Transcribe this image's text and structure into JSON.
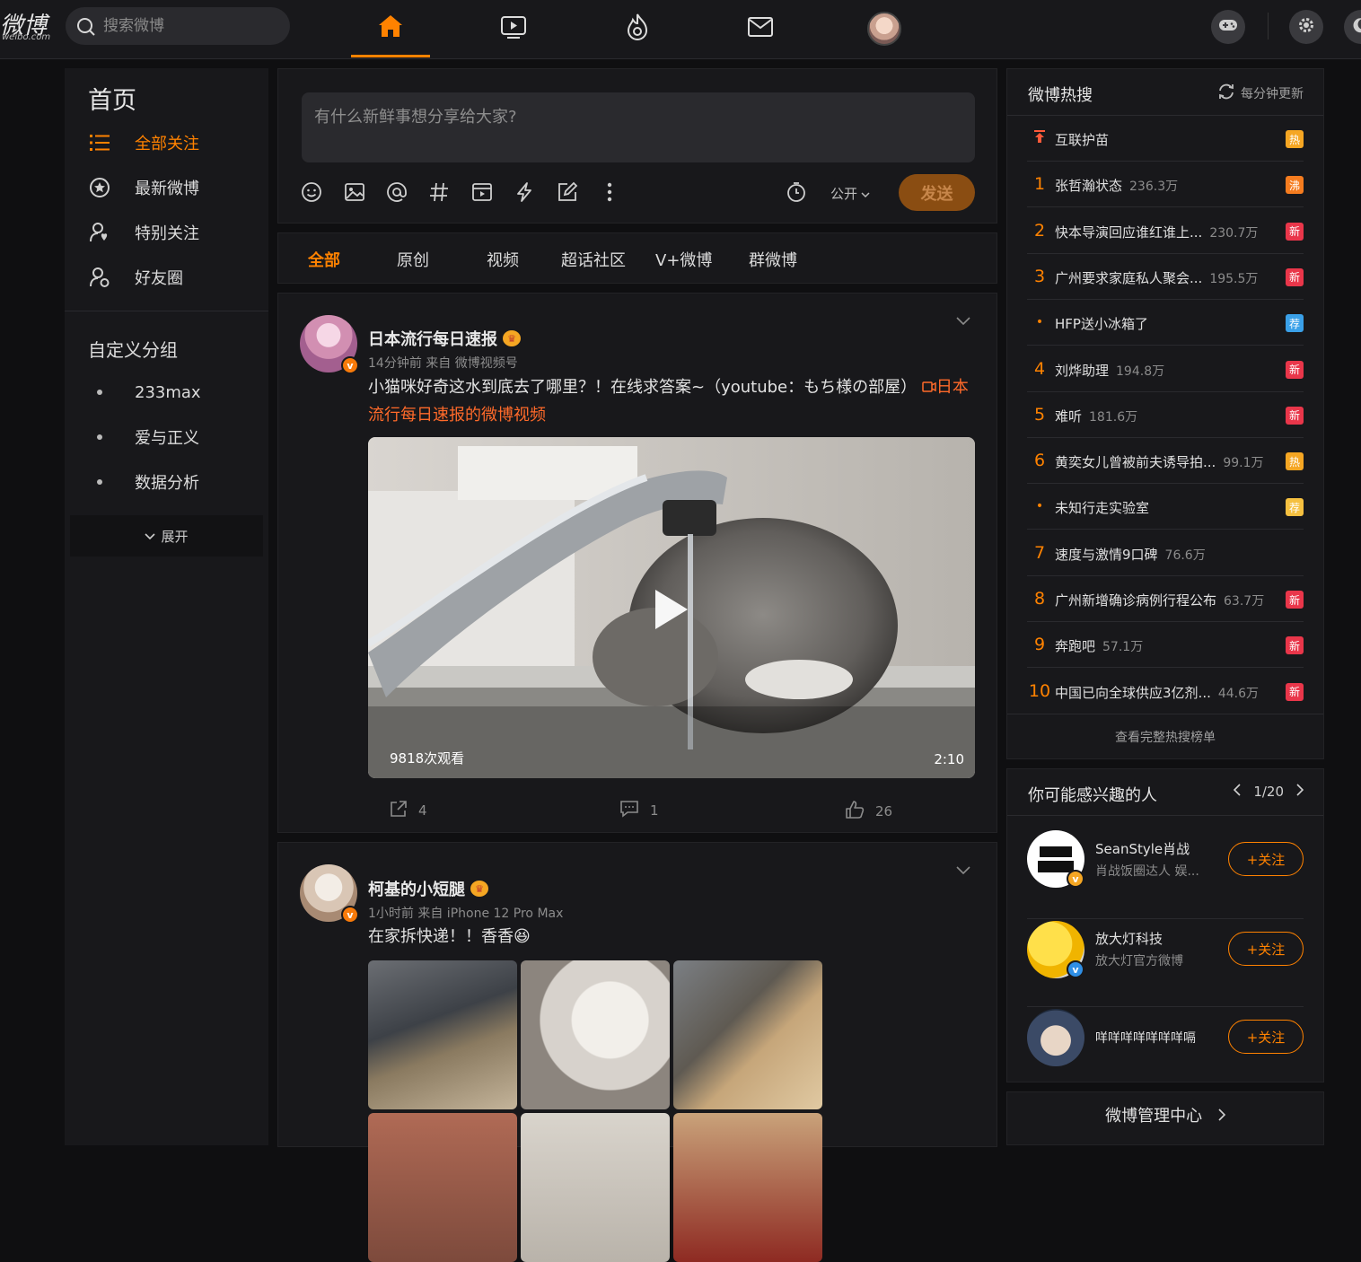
{
  "header": {
    "logo_text": "微博",
    "logo_sub": "weibo.com",
    "search_placeholder": "搜索微博",
    "nav": [
      "home-icon",
      "video-icon",
      "hot-icon",
      "mail-icon",
      "avatar"
    ]
  },
  "left_nav": {
    "title": "首页",
    "items": [
      {
        "label": "全部关注",
        "icon": "list-icon",
        "active": true
      },
      {
        "label": "最新微博",
        "icon": "star-icon"
      },
      {
        "label": "特别关注",
        "icon": "special-follow-icon"
      },
      {
        "label": "好友圈",
        "icon": "friends-icon"
      }
    ],
    "groups_title": "自定义分组",
    "groups": [
      "233max",
      "爱与正义",
      "数据分析"
    ],
    "expand_label": "展开"
  },
  "composer": {
    "placeholder": "有什么新鲜事想分享给大家?",
    "visibility": "公开",
    "send_label": "发送"
  },
  "feed_tabs": [
    "全部",
    "原创",
    "视频",
    "超话社区",
    "V+微博",
    "群微博"
  ],
  "posts": [
    {
      "author": "日本流行每日速报",
      "meta": "14分钟前  来自 微博视频号",
      "text": "小猫咪好奇这水到底去了哪里？！在线求答案~（youtube：もち様の部屋）",
      "link": "日本流行每日速报的微博视频",
      "video_views": "9818次观看",
      "video_duration": "2:10",
      "reposts": "4",
      "comments": "1",
      "likes": "26"
    },
    {
      "author": "柯基的小短腿",
      "meta": "1小时前  来自 iPhone 12 Pro Max",
      "text": "在家拆快递！！香香"
    }
  ],
  "hot_search": {
    "title": "微博热搜",
    "refresh": "每分钟更新",
    "items": [
      {
        "rank": "",
        "topic": "互联护苗",
        "count": "",
        "badge": "热",
        "badge_color": "#f5a623"
      },
      {
        "rank": "1",
        "topic": "张哲瀚状态",
        "count": "236.3万",
        "badge": "沸",
        "badge_color": "#f57c1f"
      },
      {
        "rank": "2",
        "topic": "快本导演回应谁红谁上...",
        "count": "230.7万",
        "badge": "新",
        "badge_color": "#e9364a"
      },
      {
        "rank": "3",
        "topic": "广州要求家庭私人聚会...",
        "count": "195.5万",
        "badge": "新",
        "badge_color": "#e9364a"
      },
      {
        "rank": "•",
        "topic": "HFP送小冰箱了",
        "count": "",
        "badge": "荐",
        "badge_color": "#3aa0e8"
      },
      {
        "rank": "4",
        "topic": "刘烨助理",
        "count": "194.8万",
        "badge": "新",
        "badge_color": "#e9364a"
      },
      {
        "rank": "5",
        "topic": "难听",
        "count": "181.6万",
        "badge": "新",
        "badge_color": "#e9364a"
      },
      {
        "rank": "6",
        "topic": "黄奕女儿曾被前夫诱导拍...",
        "count": "99.1万",
        "badge": "热",
        "badge_color": "#f5a623"
      },
      {
        "rank": "•",
        "topic": "未知行走实验室",
        "count": "",
        "badge": "荐",
        "badge_color": "#f5c040"
      },
      {
        "rank": "7",
        "topic": "速度与激情9口碑",
        "count": "76.6万",
        "badge": "",
        "badge_color": ""
      },
      {
        "rank": "8",
        "topic": "广州新增确诊病例行程公布",
        "count": "63.7万",
        "badge": "新",
        "badge_color": "#e9364a"
      },
      {
        "rank": "9",
        "topic": "奔跑吧",
        "count": "57.1万",
        "badge": "新",
        "badge_color": "#e9364a"
      },
      {
        "rank": "10",
        "topic": "中国已向全球供应3亿剂...",
        "count": "44.6万",
        "badge": "新",
        "badge_color": "#e9364a"
      }
    ],
    "more": "查看完整热搜榜单"
  },
  "suggest": {
    "title": "你可能感兴趣的人",
    "page": "1/20",
    "people": [
      {
        "name": "SeanStyle肖战",
        "desc": "肖战饭圈达人 娱...",
        "follow": "+关注"
      },
      {
        "name": "放大灯科技",
        "desc": "放大灯官方微博",
        "follow": "+关注"
      },
      {
        "name": "咩咩咩咩咩咩咩嗝",
        "desc": "",
        "follow": "+关注"
      }
    ]
  },
  "manage": {
    "label": "微博管理中心"
  },
  "colors": {
    "accent": "#ff8200",
    "panel": "#18181b",
    "bg": "#0f0f11"
  }
}
